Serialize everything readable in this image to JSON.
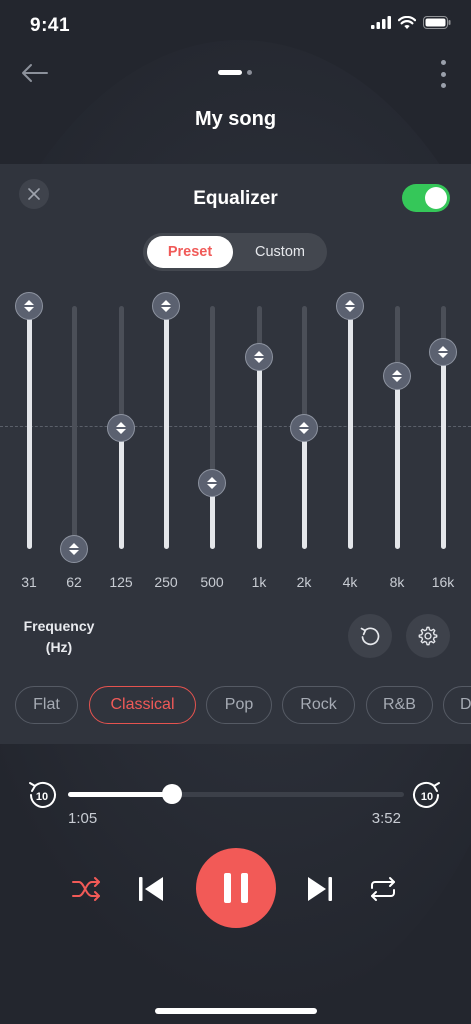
{
  "status_bar": {
    "time": "9:41"
  },
  "header": {
    "song_title": "My song"
  },
  "equalizer": {
    "title": "Equalizer",
    "enabled": true,
    "mode_tabs": [
      "Preset",
      "Custom"
    ],
    "selected_mode": "Preset",
    "bands": [
      {
        "label": "31",
        "level": 1.0
      },
      {
        "label": "62",
        "level": 0.0
      },
      {
        "label": "125",
        "level": 0.5
      },
      {
        "label": "250",
        "level": 1.0
      },
      {
        "label": "500",
        "level": 0.27
      },
      {
        "label": "1k",
        "level": 0.79
      },
      {
        "label": "2k",
        "level": 0.5
      },
      {
        "label": "4k",
        "level": 1.0
      },
      {
        "label": "8k",
        "level": 0.71
      },
      {
        "label": "16k",
        "level": 0.81
      }
    ],
    "frequency_label_line1": "Frequency",
    "frequency_label_line2": "(Hz)",
    "presets": [
      "Flat",
      "Classical",
      "Pop",
      "Rock",
      "R&B",
      "D"
    ],
    "selected_preset": "Classical"
  },
  "player": {
    "skip_back_seconds": "10",
    "skip_forward_seconds": "10",
    "current_time": "1:05",
    "total_time": "3:52",
    "progress": 0.31
  },
  "colors": {
    "accent": "#f25a57",
    "toggle_on": "#35c759",
    "panel_bg": "#30343d",
    "screen_bg": "#23262e"
  },
  "icons": {
    "back": "arrow-left-icon",
    "more": "more-vertical-icon",
    "close": "close-icon",
    "reset": "reset-icon",
    "settings": "gear-icon",
    "shuffle": "shuffle-icon",
    "previous": "skip-previous-icon",
    "pause": "pause-icon",
    "next": "skip-next-icon",
    "repeat": "repeat-icon"
  }
}
